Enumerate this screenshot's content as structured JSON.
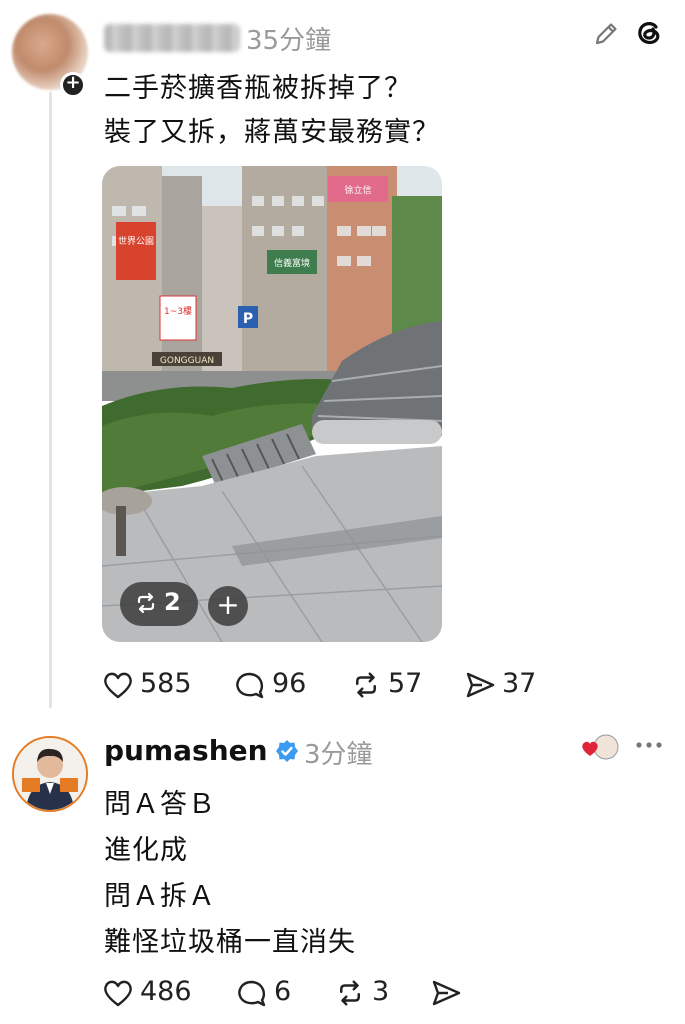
{
  "post": {
    "username": "Yi_yuan",
    "time": "35分鐘",
    "text_line1": "二手菸擴香瓶被拆掉了？",
    "text_line2": "裝了又拆，蔣萬安最務實？",
    "photo": {
      "repost_count": "2",
      "add_label": "+",
      "sign_texts": [
        "世界公園",
        "1~3樓",
        "信義富境",
        "GONGGUAN",
        "徐立信"
      ]
    },
    "actions": {
      "likes": "585",
      "comments": "96",
      "reposts": "57",
      "shares": "37"
    }
  },
  "reply": {
    "username": "pumashen",
    "time": "3分鐘",
    "lines": [
      "問Ａ答Ｂ",
      "進化成",
      "問Ａ拆Ａ",
      "難怪垃圾桶一直消失"
    ],
    "actions": {
      "likes": "486",
      "comments": "6",
      "reposts": "3"
    }
  },
  "icons": {
    "edit": "pencil-icon",
    "app": "threads-logo-icon",
    "like": "heart-icon",
    "comment": "comment-bubble-icon",
    "repost": "repost-icon",
    "share": "share-arrow-icon",
    "verified": "verified-badge-icon",
    "more": "more-dots-icon"
  },
  "colors": {
    "verified": "#3b9bf0",
    "heart_badge": "#e0243a",
    "muted_text": "#9a9a9a",
    "avatar_border": "#e57c24"
  }
}
